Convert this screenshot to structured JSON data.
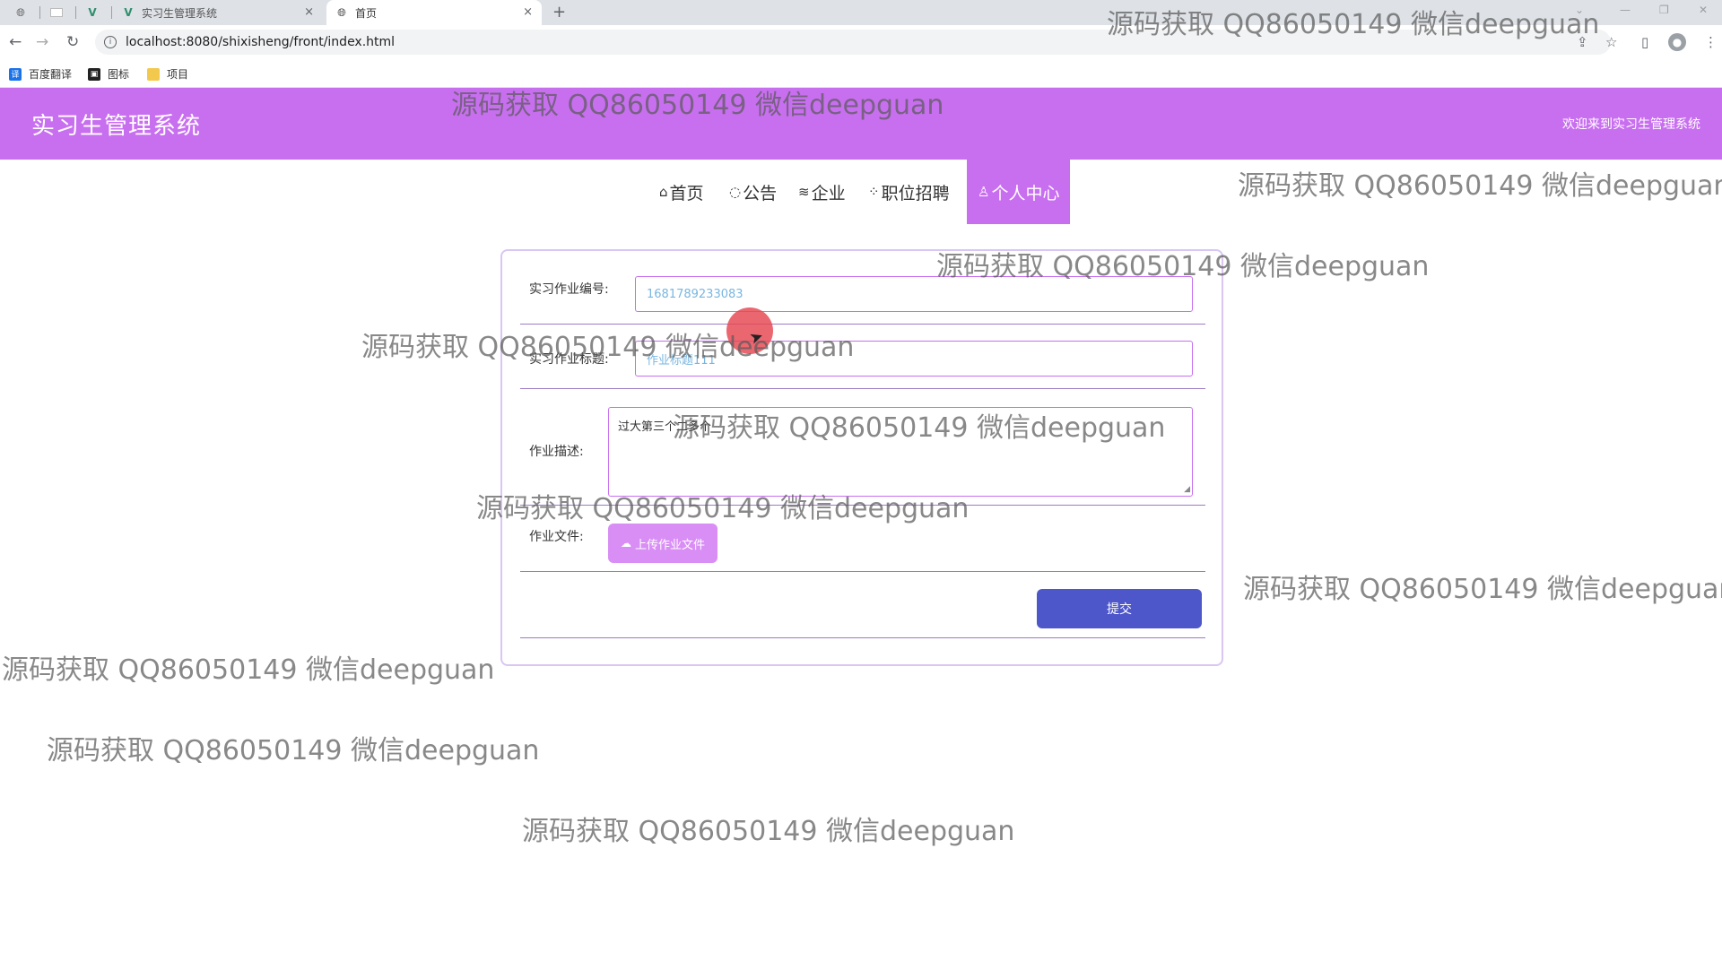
{
  "browser": {
    "tabs": [
      {
        "title": "实习生管理系统"
      },
      {
        "title": "首页"
      }
    ],
    "new_tab_symbol": "+",
    "close_symbol": "×",
    "url": "localhost:8080/shixisheng/front/index.html",
    "bookmarks": [
      {
        "label": "百度翻译",
        "icon": "translate-icon",
        "color": "#1a73e8"
      },
      {
        "label": "图标",
        "icon": "image-icon",
        "color": "#222222"
      },
      {
        "label": "项目",
        "icon": "folder-icon",
        "color": "#f2c94c"
      }
    ]
  },
  "header": {
    "title": "实习生管理系统",
    "welcome": "欢迎来到实习生管理系统",
    "color": "#c86ff0"
  },
  "nav": {
    "items": [
      {
        "label": "首页",
        "icon": "home-icon"
      },
      {
        "label": "公告",
        "icon": "bell-icon"
      },
      {
        "label": "企业",
        "icon": "graduation-cap-icon"
      },
      {
        "label": "职位招聘",
        "icon": "grid-icon"
      },
      {
        "label": "个人中心",
        "icon": "user-icon",
        "active": true
      }
    ]
  },
  "form": {
    "fields": [
      {
        "label": "实习作业编号:",
        "value": "1681789233083"
      },
      {
        "label": "实习作业标题:",
        "value": "作业标题111"
      },
      {
        "label": "作业描述:",
        "value": "过大第三个二多个"
      },
      {
        "label": "作业文件:"
      }
    ],
    "upload_label": "上传作业文件",
    "submit_label": "提交",
    "accent": "#c86ff0",
    "submit_color": "#4e57c9"
  },
  "watermark": "源码获取 QQ86050149 微信deepguan"
}
